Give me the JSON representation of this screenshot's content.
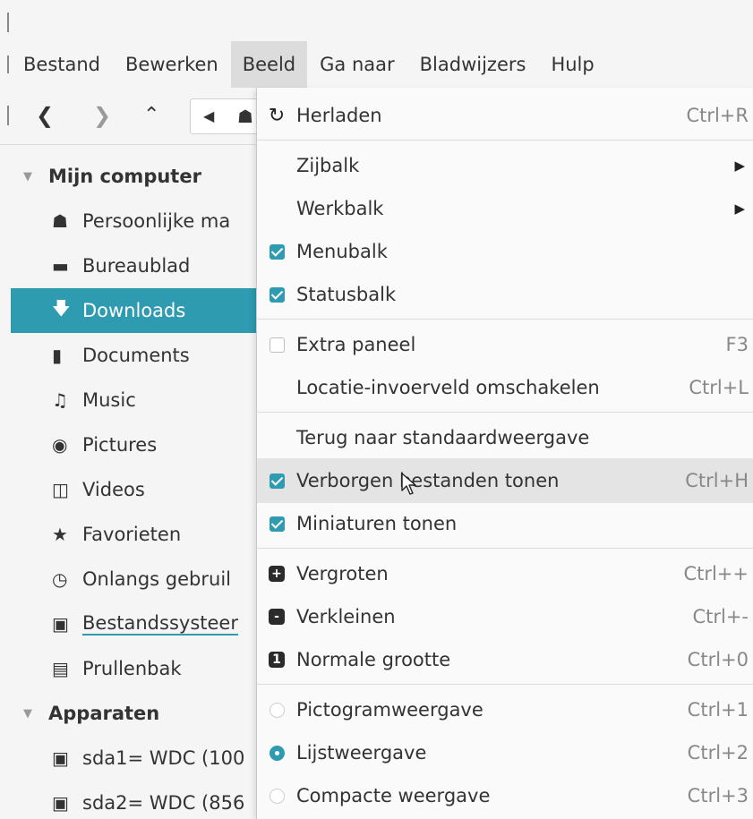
{
  "menubar": {
    "items": [
      {
        "label": "Bestand"
      },
      {
        "label": "Bewerken"
      },
      {
        "label": "Beeld"
      },
      {
        "label": "Ga naar"
      },
      {
        "label": "Bladwijzers"
      },
      {
        "label": "Hulp"
      }
    ],
    "active_index": 2
  },
  "toolbar": {
    "back_icon": "chevron-left-icon",
    "forward_icon": "chevron-right-icon",
    "up_icon": "chevron-up-icon"
  },
  "sidebar": {
    "sections": [
      {
        "header": "Mijn computer",
        "items": [
          {
            "label": "Persoonlijke ma",
            "icon": "home-icon"
          },
          {
            "label": "Bureaublad",
            "icon": "desktop-icon"
          },
          {
            "label": "Downloads",
            "icon": "download-icon",
            "selected": true
          },
          {
            "label": "Documents",
            "icon": "document-icon"
          },
          {
            "label": "Music",
            "icon": "music-icon"
          },
          {
            "label": "Pictures",
            "icon": "camera-icon"
          },
          {
            "label": "Videos",
            "icon": "film-icon"
          },
          {
            "label": "Favorieten",
            "icon": "star-icon"
          },
          {
            "label": "Onlangs gebruil",
            "icon": "clock-icon"
          },
          {
            "label": "Bestandssysteer",
            "icon": "drive-icon"
          },
          {
            "label": "Prullenbak",
            "icon": "trash-icon"
          }
        ]
      },
      {
        "header": "Apparaten",
        "items": [
          {
            "label": "sda1= WDC (100",
            "icon": "drive-icon"
          },
          {
            "label": "sda2= WDC (856",
            "icon": "drive-icon"
          }
        ]
      }
    ]
  },
  "view_menu": {
    "items": [
      {
        "label": "Herladen",
        "shortcut": "Ctrl+R",
        "lead": "reload"
      },
      {
        "label": "Zijbalk",
        "submenu": true
      },
      {
        "label": "Werkbalk",
        "submenu": true
      },
      {
        "label": "Menubalk",
        "checked": true
      },
      {
        "label": "Statusbalk",
        "checked": true
      },
      {
        "label": "Extra paneel",
        "shortcut": "F3",
        "checked": false
      },
      {
        "label": "Locatie-invoerveld omschakelen",
        "shortcut": "Ctrl+L"
      },
      {
        "label": "Terug naar standaardweergave"
      },
      {
        "label": "Verborgen bestanden tonen",
        "shortcut": "Ctrl+H",
        "checked": true,
        "hovered": true
      },
      {
        "label": "Miniaturen tonen",
        "checked": true
      },
      {
        "label": "Vergroten",
        "shortcut": "Ctrl++",
        "lead": "+"
      },
      {
        "label": "Verkleinen",
        "shortcut": "Ctrl+-",
        "lead": "-"
      },
      {
        "label": "Normale grootte",
        "shortcut": "Ctrl+0",
        "lead": "1"
      },
      {
        "label": "Pictogramweergave",
        "shortcut": "Ctrl+1",
        "radio": false
      },
      {
        "label": "Lijstweergave",
        "shortcut": "Ctrl+2",
        "radio": true
      },
      {
        "label": "Compacte weergave",
        "shortcut": "Ctrl+3",
        "radio": false
      }
    ]
  },
  "colors": {
    "accent": "#2e9bb0",
    "menu_bg": "#fafafa",
    "hover_bg": "#e4e4e4",
    "shortcut_text": "#888888"
  }
}
